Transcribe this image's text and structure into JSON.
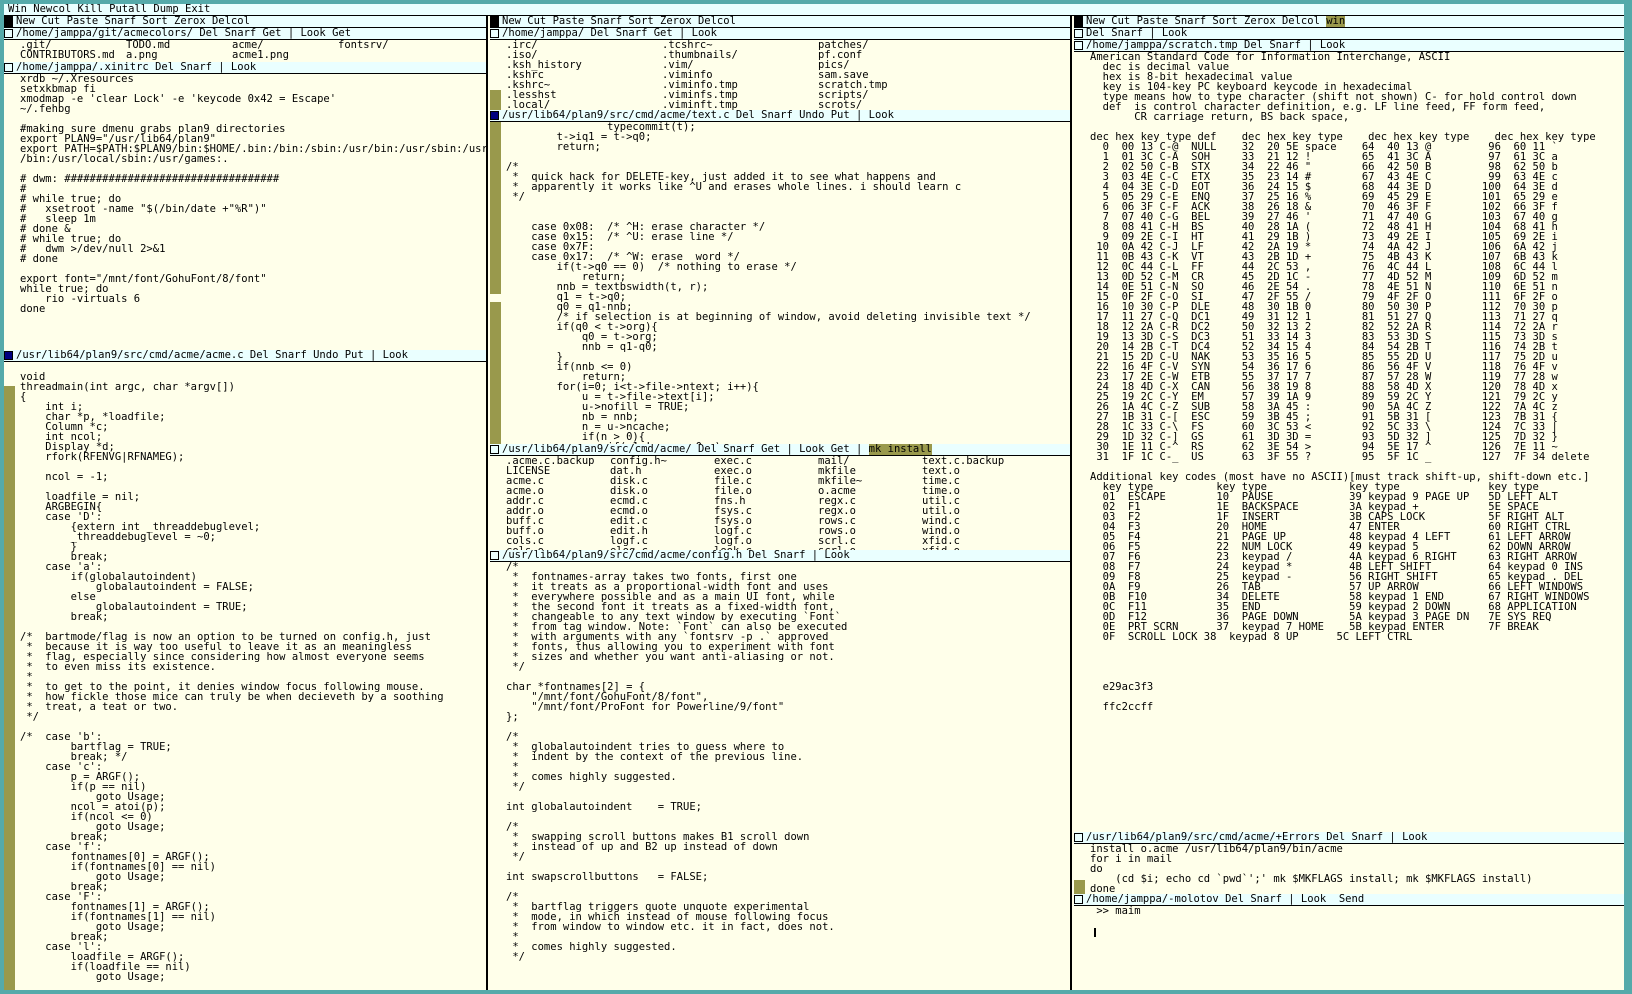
{
  "row_tag": "Win Newcol Kill Putall Dump Exit",
  "columns": [
    {
      "tag": "New Cut Paste Snarf Sort Zerox Delcol",
      "windows": [
        {
          "tag": "/home/jamppa/git/acmecolors/ Del Snarf Get | Look Get",
          "grid": [
            ".git/\nCONTRIBUTORS.md",
            "TODO.md\na.png",
            "acme/\nacme1.png",
            "fontsrv/"
          ]
        },
        {
          "tag": "/home/jamppa/.xinitrc Del Snarf | Look",
          "text": "xrdb ~/.Xresources\nsetxkbmap fi\nxmodmap -e 'clear Lock' -e 'keycode 0x42 = Escape'\n~/.fehbg\n\n#making sure dmenu grabs plan9 directories\nexport PLAN9=\"/usr/lib64/plan9\"\nexport PATH=$PATH:$PLAN9/bin:$HOME/.bin:/bin:/sbin:/usr/bin:/usr/sbin:/usr/local\n/bin:/usr/local/sbin:/usr/games:.\n\n# dwm: ##################################\n#\n# while true; do\n#   xsetroot -name \"$(/bin/date +\"%R\")\"\n#   sleep 1m\n# done &\n# while true; do\n#   dwm >/dev/null 2>&1\n# done\n\nexport font=\"/mnt/font/GohuFont/8/font\"\nwhile true; do\n    rio -virtuals 6\ndone"
        },
        {
          "tag": "/usr/lib64/plan9/src/cmd/acme/acme.c Del Snarf Undo Put | Look",
          "text": "\nvoid\nthreadmain(int argc, char *argv[])\n{\n    int i;\n    char *p, *loadfile;\n    Column *c;\n    int ncol;\n    Display *d;\n    rfork(RFENVG|RFNAMEG);\n\n    ncol = -1;\n\n    loadfile = nil;\n    ARGBEGIN{\n    case 'D':\n        {extern int _threaddebuglevel;\n        _threaddebuglevel = ~0;\n        }\n        break;\n    case 'a':\n        if(globalautoindent)\n            globalautoindent = FALSE;\n        else\n            globalautoindent = TRUE;\n        break;\n\n/*  bartmode/flag is now an option to be turned on config.h, just\n *  because it is way too useful to leave it as an meaningless\n *  flag, especially since considering how almost everyone seems\n *  to even miss its existence.\n *\n *  to get to the point, it denies window focus following mouse.\n *  how fickle those mice can truly be when decieveth by a soothing\n *  treat, a teat or two.\n */\n\n/*  case 'b':\n        bartflag = TRUE;\n        break; */\n    case 'c':\n        p = ARGF();\n        if(p == nil)\n            goto Usage;\n        ncol = atoi(p);\n        if(ncol <= 0)\n            goto Usage;\n        break;\n    case 'f':\n        fontnames[0] = ARGF();\n        if(fontnames[0] == nil)\n            goto Usage;\n        break;\n    case 'F':\n        fontnames[1] = ARGF();\n        if(fontnames[1] == nil)\n            goto Usage;\n        break;\n    case 'l':\n        loadfile = ARGF();\n        if(loadfile == nil)\n            goto Usage;"
        }
      ]
    },
    {
      "tag": "New Cut Paste Snarf Sort Zerox Delcol",
      "windows": [
        {
          "tag": "/home/jamppa/ Del Snarf Get | Look",
          "grid": [
            ".irc/\n.iso/\n.ksh_history\n.kshrc\n.kshrc~\n.lesshst\n.local/",
            ".tcshrc~\n.thumbnails/\n.vim/\n.viminfo\n.viminfo.tmp\n.viminfs.tmp\n.viminft.tmp",
            "patches/\npf.conf\npics/\nsam.save\nscratch.tmp\nscripts/\nscrots/"
          ]
        },
        {
          "tag": "/usr/lib64/plan9/src/cmd/acme/text.c Del Snarf Undo Put | Look",
          "text": "                typecommit(t);\n        t->iq1 = t->q0;\n        return;\n\n/*\n *  quick hack for DELETE-key, just added it to see what happens and\n *  apparently it works like ^U and erases whole lines. i should learn c\n */\n\n\n    case 0x08:  /* ^H: erase character */\n    case 0x15:  /* ^U: erase line */\n    case 0x7F:\n    case 0x17:  /* ^W: erase  word */\n        if(t->q0 == 0)  /* nothing to erase */\n            return;\n        nnb = textbswidth(t, r);\n        q1 = t->q0;\n        q0 = q1-nnb;\n        /* if selection is at beginning of window, avoid deleting invisible text */\n        if(q0 < t->org){\n            q0 = t->org;\n            nnb = q1-q0;\n        }\n        if(nnb <= 0)\n            return;\n        for(i=0; i<t->file->ntext; i++){\n            u = t->file->text[i];\n            u->nofill = TRUE;\n            nb = nnb;\n            n = u->ncache;\n            if(n > 0){\n                if(q1 != u->cq0+n)\n                    error(\"text.type backspace\");"
        },
        {
          "tag": "/usr/lib64/plan9/src/cmd/acme/ Del Snarf Get | Look Get |",
          "tag_hl": "mk install",
          "grid": [
            ".acme.c.backup\nLICENSE\nacme.c\nacme.o\naddr.c\naddr.o\nbuff.c\nbuff.o\ncols.c\ncols.o",
            "config.h~\ndat.h\ndisk.c\ndisk.o\necmd.c\necmd.o\nedit.c\nedit.h\nlogf.c\nelog.c",
            "exec.c\nexec.o\nfile.c\nfile.o\nfns.h\nfsys.c\nfsys.o\nlogf.c\nlogf.o\nlook.c",
            "mail/\nmkfile\nmkfile~\no.acme\nregx.c\nregx.o\nrows.c\nrows.o\nscrl.c\nscrl.o",
            "text.c.backup\ntext.o\ntime.c\ntime.o\nutil.c\nutil.o\nwind.c\nwind.o\nxfid.c\nxfid.o"
          ]
        },
        {
          "tag": "/usr/lib64/plan9/src/cmd/acme/config.h Del Snarf | Look",
          "text": "/*\n *  fontnames-array takes two fonts, first one\n *  it treats as a proportional-width font and uses\n *  everywhere possible and as a main UI font, while\n *  the second font it treats as a fixed-width font,\n *  changeable to any text window by executing `Font`\n *  from tag window. Note: `Font` can also be executed\n *  with arguments with any `fontsrv -p .` approved\n *  fonts, thus allowing you to experiment with font\n *  sizes and whether you want anti-aliasing or not.\n */\n\nchar *fontnames[2] = {\n    \"/mnt/font/GohuFont/8/font\",\n    \"/mnt/font/ProFont for Powerline/9/font\"\n};\n\n/*\n *  globalautoindent tries to guess where to\n *  indent by the context of the previous line.\n *\n *  comes highly suggested.\n */\n\nint globalautoindent    = TRUE;\n\n/*\n *  swapping scroll buttons makes B1 scroll down\n *  instead of up and B2 up instead of down\n */\n\nint swapscrollbuttons   = FALSE;\n\n/*\n *  bartflag triggers quote unquote experimental\n *  mode, in which instead of mouse following focus\n *  from window to window etc. it in fact, does not.\n *\n *  comes highly suggested.\n */"
        }
      ]
    },
    {
      "tag": "New Cut Paste Snarf Sort Zerox Delcol",
      "tag_hl": "win",
      "windows": [
        {
          "tag": "Del Snarf | Look",
          "text": ""
        },
        {
          "tag": "/home/jamppa/scratch.tmp Del Snarf | Look",
          "text": "American Standard Code for Information Interchange, ASCII\n  dec is decimal value\n  hex is 8-bit hexadecimal value\n  key is 104-key PC keyboard keycode in hexadecimal\n  type means how to type character (shift not shown) C- for hold control down\n  def  is control character definition, e.g. LF line feed, FF form feed,\n       CR carriage return, BS back space,\n\ndec hex key type def    dec hex key type    dec hex key type    dec hex key type\n  0  00 13 C-@  NULL    32  20 5E space    64  40 13 @         96  60 11 `\n  1  01 3C C-A  SOH     33  21 12 !        65  41 3C A         97  61 3C a\n  2  02 50 C-B  STX     34  22 46 \"        66  42 50 B         98  62 50 b\n  3  03 4E C-C  ETX     35  23 14 #        67  43 4E C         99  63 4E c\n  4  04 3E C-D  EOT     36  24 15 $        68  44 3E D        100  64 3E d\n  5  05 29 C-E  ENQ     37  25 16 %        69  45 29 E        101  65 29 e\n  6  06 3F C-F  ACK     38  26 18 &        70  46 3F F        102  66 3F f\n  7  07 40 C-G  BEL     39  27 46 '        71  47 40 G        103  67 40 g\n  8  08 41 C-H  BS      40  28 1A (        72  48 41 H        104  68 41 h\n  9  09 2E C-I  HT      41  29 1B )        73  49 2E I        105  69 2E i\n 10  0A 42 C-J  LF      42  2A 19 *        74  4A 42 J        106  6A 42 j\n 11  0B 43 C-K  VT      43  2B 1D +        75  4B 43 K        107  6B 43 k\n 12  0C 44 C-L  FF      44  2C 53 ,        76  4C 44 L        108  6C 44 l\n 13  0D 52 C-M  CR      45  2D 1C -        77  4D 52 M        109  6D 52 m\n 14  0E 51 C-N  SO      46  2E 54 .        78  4E 51 N        110  6E 51 n\n 15  0F 2F C-O  SI      47  2F 55 /        79  4F 2F O        111  6F 2F o\n 16  10 30 C-P  DLE     48  30 1B 0        80  50 30 P        112  70 30 p\n 17  11 27 C-Q  DC1     49  31 12 1        81  51 27 Q        113  71 27 q\n 18  12 2A C-R  DC2     50  32 13 2        82  52 2A R        114  72 2A r\n 19  13 3D C-S  DC3     51  33 14 3        83  53 3D S        115  73 3D s\n 20  14 2B C-T  DC4     52  34 15 4        84  54 2B T        116  74 2B t\n 21  15 2D C-U  NAK     53  35 16 5        85  55 2D U        117  75 2D u\n 22  16 4F C-V  SYN     54  36 17 6        86  56 4F V        118  76 4F v\n 23  17 2E C-W  ETB     55  37 17 7        87  57 28 W        119  77 28 w\n 24  18 4D C-X  CAN     56  38 19 8        88  58 4D X        120  78 4D x\n 25  19 2C C-Y  EM      57  39 1A 9        89  59 2C Y        121  79 2C y\n 26  1A 4C C-Z  SUB     58  3A 45 :        90  5A 4C Z        122  7A 4C z\n 27  1B 31 C-[  ESC     59  3B 45 ;        91  5B 31 [        123  7B 31 {\n 28  1C 33 C-\\  FS      60  3C 53 <        92  5C 33 \\        124  7C 33 |\n 29  1D 32 C-]  GS      61  3D 3D =        93  5D 32 ]        125  7D 32 }\n 30  1E 11 C-^  RS      62  3E 54 >        94  5E 17 ^        126  7E 11 ~\n 31  1F 1C C-_  US      63  3F 55 ?        95  5F 1C _        127  7F 34 delete\n\nAdditional key codes (most have no ASCII)[must track shift-up, shift-down etc.]\n  key type          key type             key type              key type\n  01  ESCAPE        10  PAUSE            39 keypad 9 PAGE UP   5D LEFT ALT\n  02  F1            1E  BACKSPACE        3A keypad +           5E SPACE\n  03  F2            1F  INSERT           3B CAPS LOCK          5F RIGHT ALT\n  04  F3            20  HOME             47 ENTER              60 RIGHT CTRL\n  05  F4            21  PAGE UP          48 keypad 4 LEFT      61 LEFT ARROW\n  06  F5            22  NUM LOCK         49 keypad 5           62 DOWN ARROW\n  07  F6            23  keypad /         4A keypad 6 RIGHT     63 RIGHT ARROW\n  08  F7            24  keypad *         4B LEFT SHIFT         64 keypad 0 INS\n  09  F8            25  keypad -         56 RIGHT SHIFT        65 keypad . DEL\n  0A  F9            26  TAB              57 UP ARROW           66 LEFT WINDOWS\n  0B  F10           34  DELETE           58 keypad 1 END       67 RIGHT WINDOWS\n  0C  F11           35  END              59 keypad 2 DOWN      68 APPLICATION\n  0D  F12           36  PAGE DOWN        5A keypad 3 PAGE DN   7E SYS REQ\n  0E  PRT SCRN      37  keypad 7 HOME    5B keypad ENTER       7F BREAK\n  0F  SCROLL LOCK 38  keypad 8 UP      5C LEFT CTRL\n\n\n\n\n  e29ac3f3\n\n  ffc2ccff"
        },
        {
          "tag": "/usr/lib64/plan9/src/cmd/acme/+Errors Del Snarf | Look",
          "text": "install o.acme /usr/lib64/plan9/bin/acme\nfor i in mail\ndo\n    (cd $i; echo cd `pwd`';' mk $MKFLAGS install; mk $MKFLAGS install)\ndone"
        },
        {
          "tag": "/home/jamppa/-molotov Del Snarf | Look  Send",
          "text": " >> maim\n"
        }
      ]
    }
  ],
  "colors": {
    "background": "#55aaaa",
    "tag": "#eaffff",
    "body": "#ffffea",
    "scroll": "#99994c",
    "dirty": "#000080"
  }
}
